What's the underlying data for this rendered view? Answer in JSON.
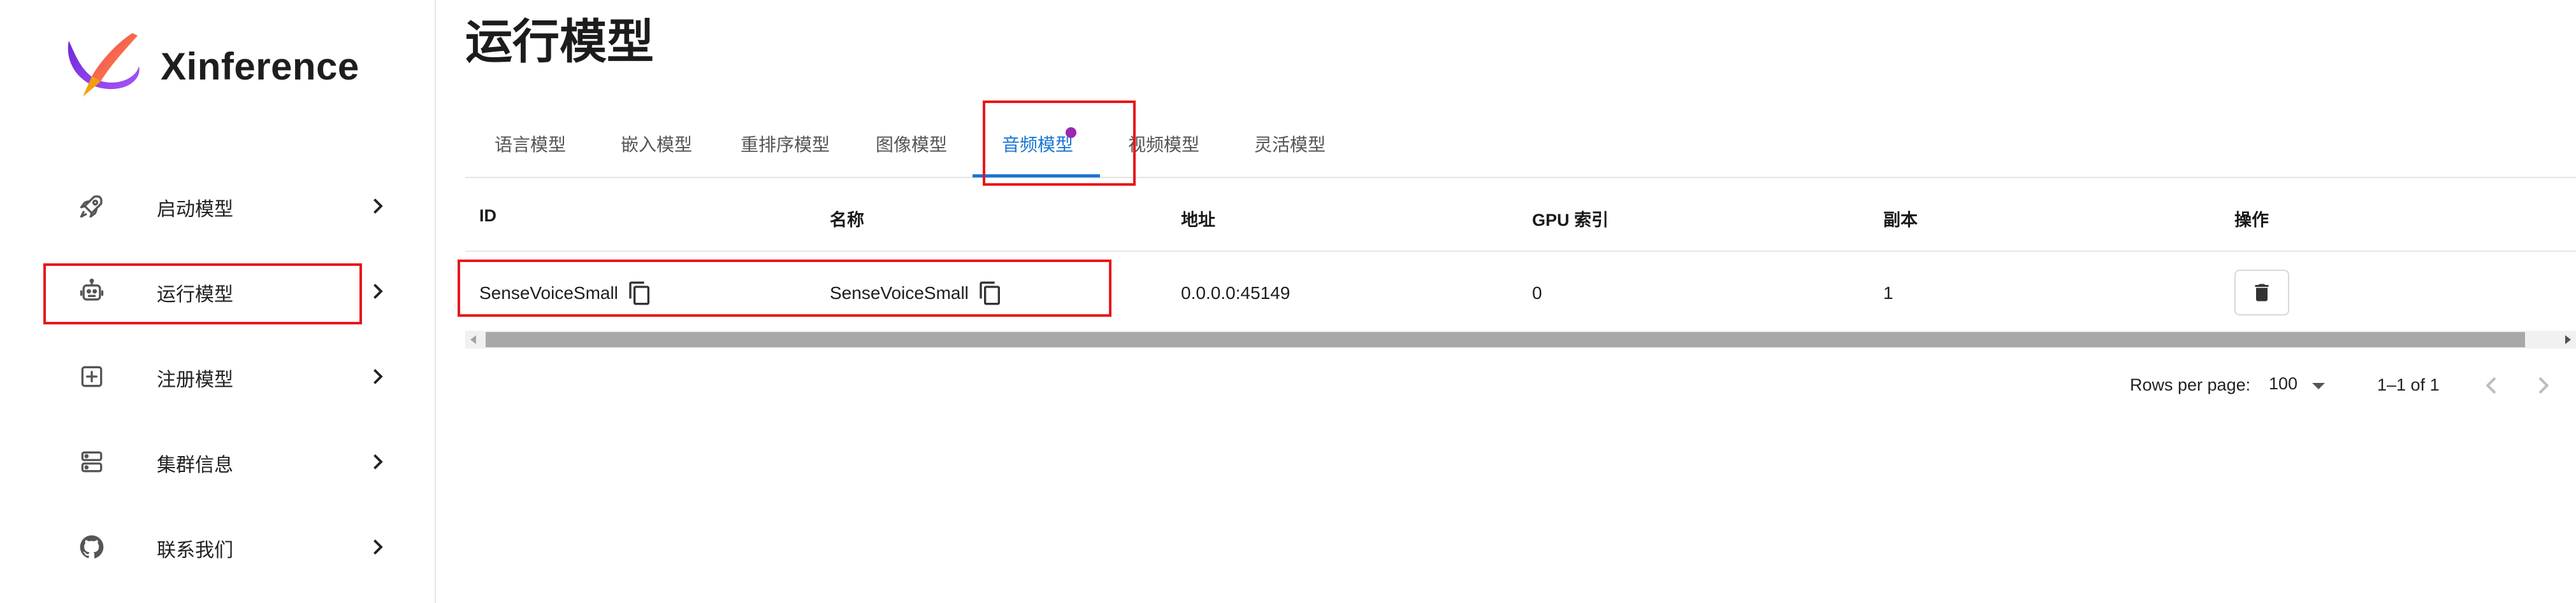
{
  "app": {
    "name": "Xinference",
    "colors": {
      "accent": "#1976d2",
      "highlight": "#e8161b",
      "badge": "#9c27b0"
    }
  },
  "sidebar": {
    "items": [
      {
        "label": "启动模型",
        "icon": "rocket-icon"
      },
      {
        "label": "运行模型",
        "icon": "robot-icon"
      },
      {
        "label": "注册模型",
        "icon": "add-box-icon"
      },
      {
        "label": "集群信息",
        "icon": "server-icon"
      },
      {
        "label": "联系我们",
        "icon": "github-icon"
      }
    ]
  },
  "main": {
    "title": "运行模型",
    "tabs": [
      {
        "label": "语言模型"
      },
      {
        "label": "嵌入模型"
      },
      {
        "label": "重排序模型"
      },
      {
        "label": "图像模型"
      },
      {
        "label": "音频模型",
        "active": true
      },
      {
        "label": "视频模型"
      },
      {
        "label": "灵活模型"
      }
    ],
    "table": {
      "columns": [
        "ID",
        "名称",
        "地址",
        "GPU 索引",
        "副本",
        "操作"
      ],
      "rows": [
        {
          "id": "SenseVoiceSmall",
          "name": "SenseVoiceSmall",
          "address": "0.0.0.0:45149",
          "gpu": "0",
          "replica": "1"
        }
      ]
    },
    "pagination": {
      "rows_per_page_label": "Rows per page:",
      "rows_per_page_value": "100",
      "range": "1–1 of 1"
    }
  }
}
